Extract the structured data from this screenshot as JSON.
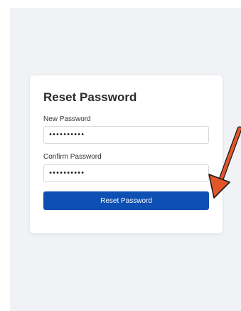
{
  "form": {
    "title": "Reset Password",
    "new_password_label": "New Password",
    "new_password_value": "••••••••••",
    "confirm_password_label": "Confirm Password",
    "confirm_password_value": "••••••••••",
    "submit_label": "Reset Password"
  },
  "annotation": {
    "icon": "arrow-icon",
    "color": "#e2572a",
    "outline_color": "#1a1a1a"
  },
  "colors": {
    "background": "#f1f2f5",
    "card": "#ffffff",
    "button": "#0d4fb3"
  }
}
